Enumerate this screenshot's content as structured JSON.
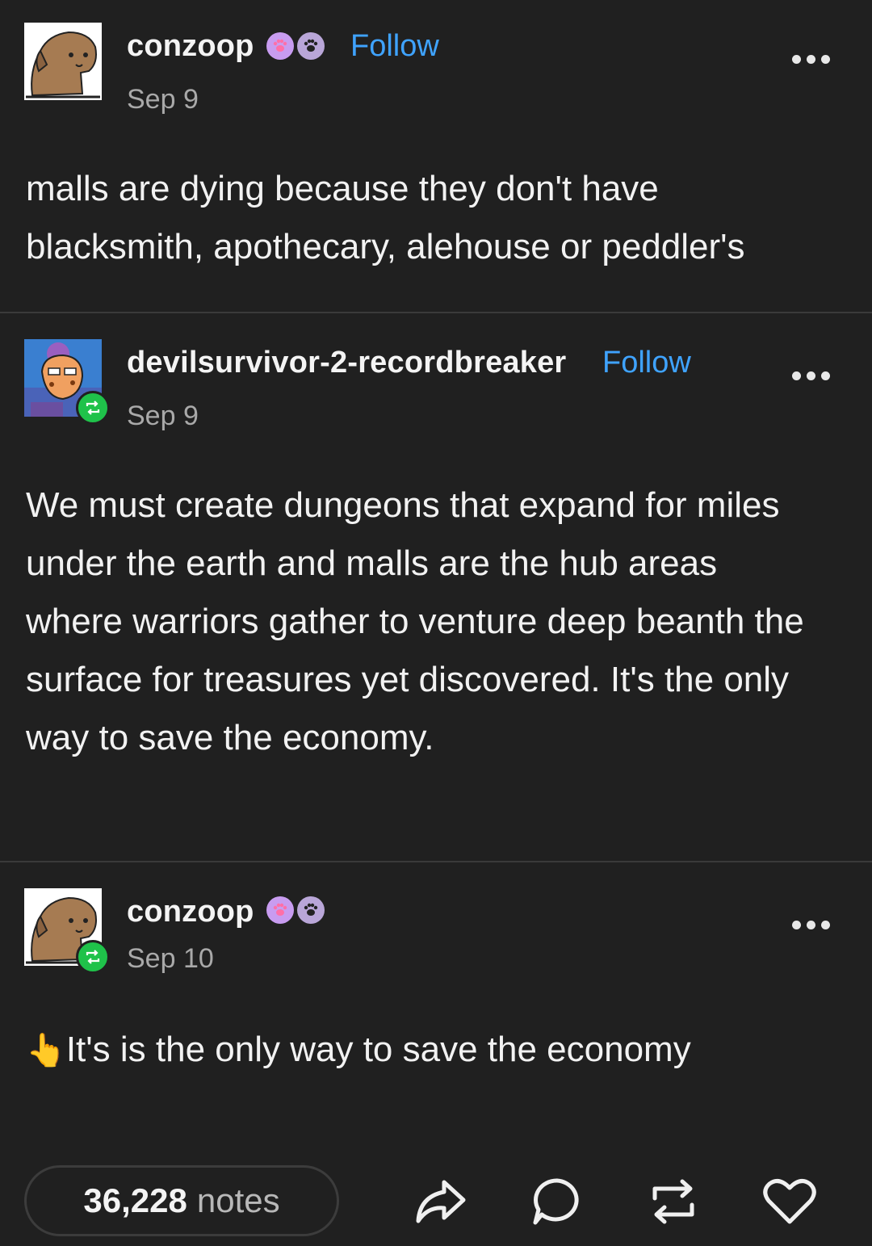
{
  "posts": [
    {
      "username": "conzoop",
      "follow_label": "Follow",
      "date": "Sep 9",
      "text": "malls are dying because they don't have blacksmith, apothecary, alehouse or peddler's",
      "avatar_icon": "dog-avatar-icon",
      "badges": [
        "paw-badge-pink-icon",
        "paw-badge-gray-icon"
      ]
    },
    {
      "username": "devilsurvivor-2-recordbreaker",
      "follow_label": "Follow",
      "date": "Sep 9",
      "text": "We must create dungeons that expand for miles under the earth and malls are the hub areas where warriors gather to venture deep beanth the surface for treasures yet discovered. It's the only way to save the economy.",
      "avatar_icon": "character-avatar-icon",
      "reblog_badge": "reblog-icon"
    },
    {
      "username": "conzoop",
      "date": "Sep 10",
      "text": "It's is the only way to save the economy",
      "emoji": "👆",
      "avatar_icon": "dog-avatar-icon",
      "reblog_badge": "reblog-icon",
      "badges": [
        "paw-badge-pink-icon",
        "paw-badge-gray-icon"
      ]
    }
  ],
  "footer": {
    "notes_count": "36,228",
    "notes_label": "notes",
    "actions": [
      "share-icon",
      "reply-icon",
      "reblog-icon",
      "like-icon"
    ]
  },
  "colors": {
    "background": "#202020",
    "follow_blue": "#3fa3ff",
    "reblog_green": "#1fc24a",
    "paw_pink": "#c89cf0",
    "paw_gray": "#b9a6d8"
  }
}
